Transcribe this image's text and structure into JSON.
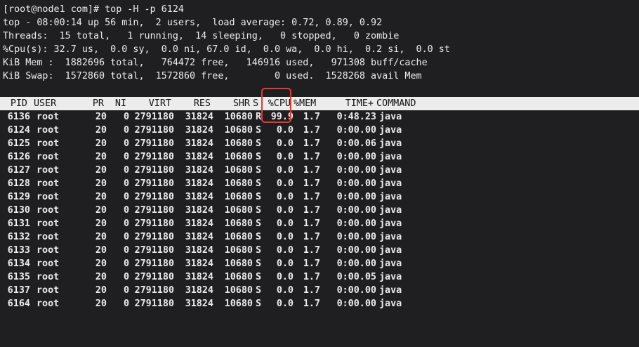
{
  "prompt_line": "[root@node1 com]# top -H -p 6124",
  "summary": {
    "top_line": "top - 08:00:14 up 56 min,  2 users,  load average: 0.72, 0.89, 0.92",
    "threads_line": "Threads:  15 total,   1 running,  14 sleeping,   0 stopped,   0 zombie",
    "cpu_line": "%Cpu(s): 32.7 us,  0.0 sy,  0.0 ni, 67.0 id,  0.0 wa,  0.0 hi,  0.2 si,  0.0 st",
    "mem_line": "KiB Mem :  1882696 total,   764472 free,   146916 used,   971308 buff/cache",
    "swap_line": "KiB Swap:  1572860 total,  1572860 free,        0 used.  1528268 avail Mem"
  },
  "columns": {
    "pid": "PID",
    "user": "USER",
    "pr": "PR",
    "ni": "NI",
    "virt": "VIRT",
    "res": "RES",
    "shr": "SHR",
    "s": "S",
    "cpu": "%CPU",
    "mem": "%MEM",
    "time": "TIME+",
    "command": "COMMAND"
  },
  "rows": [
    {
      "pid": "6136",
      "user": "root",
      "pr": "20",
      "ni": "0",
      "virt": "2791180",
      "res": "31824",
      "shr": "10680",
      "s": "R",
      "cpu": "99.9",
      "mem": "1.7",
      "time": "0:48.23",
      "command": "java"
    },
    {
      "pid": "6124",
      "user": "root",
      "pr": "20",
      "ni": "0",
      "virt": "2791180",
      "res": "31824",
      "shr": "10680",
      "s": "S",
      "cpu": "0.0",
      "mem": "1.7",
      "time": "0:00.00",
      "command": "java"
    },
    {
      "pid": "6125",
      "user": "root",
      "pr": "20",
      "ni": "0",
      "virt": "2791180",
      "res": "31824",
      "shr": "10680",
      "s": "S",
      "cpu": "0.0",
      "mem": "1.7",
      "time": "0:00.06",
      "command": "java"
    },
    {
      "pid": "6126",
      "user": "root",
      "pr": "20",
      "ni": "0",
      "virt": "2791180",
      "res": "31824",
      "shr": "10680",
      "s": "S",
      "cpu": "0.0",
      "mem": "1.7",
      "time": "0:00.00",
      "command": "java"
    },
    {
      "pid": "6127",
      "user": "root",
      "pr": "20",
      "ni": "0",
      "virt": "2791180",
      "res": "31824",
      "shr": "10680",
      "s": "S",
      "cpu": "0.0",
      "mem": "1.7",
      "time": "0:00.00",
      "command": "java"
    },
    {
      "pid": "6128",
      "user": "root",
      "pr": "20",
      "ni": "0",
      "virt": "2791180",
      "res": "31824",
      "shr": "10680",
      "s": "S",
      "cpu": "0.0",
      "mem": "1.7",
      "time": "0:00.00",
      "command": "java"
    },
    {
      "pid": "6129",
      "user": "root",
      "pr": "20",
      "ni": "0",
      "virt": "2791180",
      "res": "31824",
      "shr": "10680",
      "s": "S",
      "cpu": "0.0",
      "mem": "1.7",
      "time": "0:00.00",
      "command": "java"
    },
    {
      "pid": "6130",
      "user": "root",
      "pr": "20",
      "ni": "0",
      "virt": "2791180",
      "res": "31824",
      "shr": "10680",
      "s": "S",
      "cpu": "0.0",
      "mem": "1.7",
      "time": "0:00.00",
      "command": "java"
    },
    {
      "pid": "6131",
      "user": "root",
      "pr": "20",
      "ni": "0",
      "virt": "2791180",
      "res": "31824",
      "shr": "10680",
      "s": "S",
      "cpu": "0.0",
      "mem": "1.7",
      "time": "0:00.00",
      "command": "java"
    },
    {
      "pid": "6132",
      "user": "root",
      "pr": "20",
      "ni": "0",
      "virt": "2791180",
      "res": "31824",
      "shr": "10680",
      "s": "S",
      "cpu": "0.0",
      "mem": "1.7",
      "time": "0:00.00",
      "command": "java"
    },
    {
      "pid": "6133",
      "user": "root",
      "pr": "20",
      "ni": "0",
      "virt": "2791180",
      "res": "31824",
      "shr": "10680",
      "s": "S",
      "cpu": "0.0",
      "mem": "1.7",
      "time": "0:00.00",
      "command": "java"
    },
    {
      "pid": "6134",
      "user": "root",
      "pr": "20",
      "ni": "0",
      "virt": "2791180",
      "res": "31824",
      "shr": "10680",
      "s": "S",
      "cpu": "0.0",
      "mem": "1.7",
      "time": "0:00.00",
      "command": "java"
    },
    {
      "pid": "6135",
      "user": "root",
      "pr": "20",
      "ni": "0",
      "virt": "2791180",
      "res": "31824",
      "shr": "10680",
      "s": "S",
      "cpu": "0.0",
      "mem": "1.7",
      "time": "0:00.05",
      "command": "java"
    },
    {
      "pid": "6137",
      "user": "root",
      "pr": "20",
      "ni": "0",
      "virt": "2791180",
      "res": "31824",
      "shr": "10680",
      "s": "S",
      "cpu": "0.0",
      "mem": "1.7",
      "time": "0:00.00",
      "command": "java"
    },
    {
      "pid": "6164",
      "user": "root",
      "pr": "20",
      "ni": "0",
      "virt": "2791180",
      "res": "31824",
      "shr": "10680",
      "s": "S",
      "cpu": "0.0",
      "mem": "1.7",
      "time": "0:00.00",
      "command": "java"
    }
  ],
  "highlight": {
    "column": "cpu",
    "color": "#e43b2f"
  },
  "colors": {
    "background": "#1f1f22",
    "foreground": "#ececec",
    "header_bg": "#ececec",
    "header_fg": "#111111"
  }
}
